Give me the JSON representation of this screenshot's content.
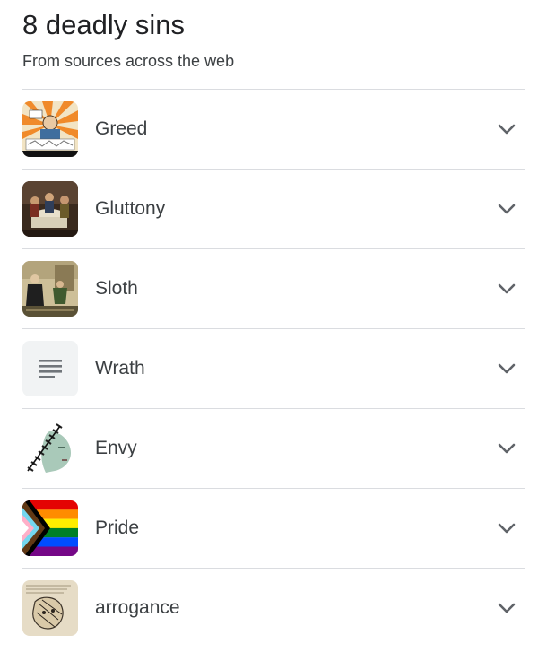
{
  "header": {
    "title": "8 deadly sins",
    "subtitle": "From sources across the web"
  },
  "items": [
    {
      "label": "Greed",
      "thumbnail": "greed-cartoon-thumbnail"
    },
    {
      "label": "Gluttony",
      "thumbnail": "gluttony-painting-thumbnail"
    },
    {
      "label": "Sloth",
      "thumbnail": "sloth-painting-thumbnail"
    },
    {
      "label": "Wrath",
      "thumbnail": "text-placeholder-icon"
    },
    {
      "label": "Envy",
      "thumbnail": "envy-face-thumbnail"
    },
    {
      "label": "Pride",
      "thumbnail": "progress-pride-flag-thumbnail"
    },
    {
      "label": "arrogance",
      "thumbnail": "arrogance-art-thumbnail"
    }
  ],
  "icons": {
    "expand": "chevron-down-icon"
  },
  "colors": {
    "divider": "#dadce0",
    "chevron": "#5f6368",
    "title": "#202124",
    "text": "#3c4043"
  }
}
